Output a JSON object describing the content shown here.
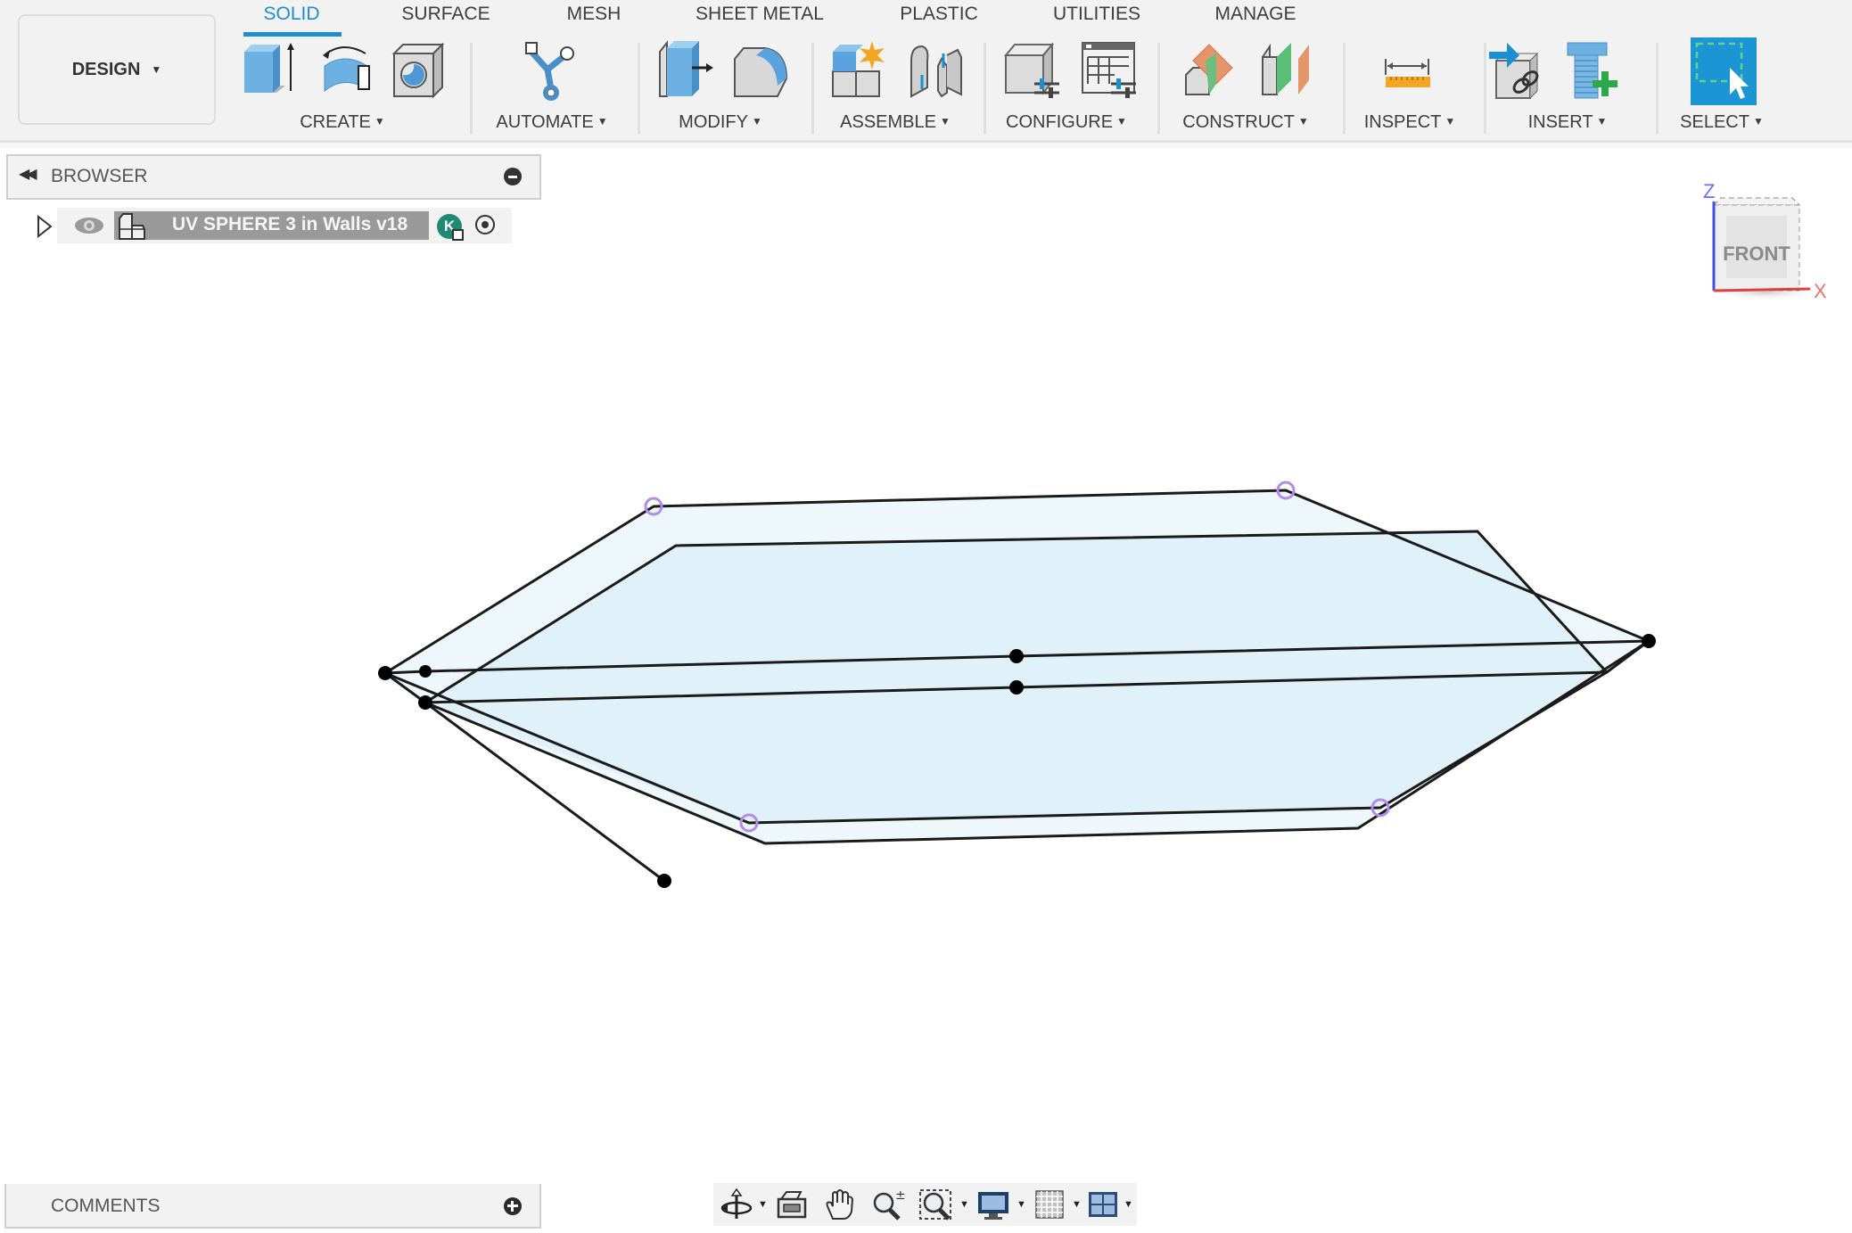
{
  "app": {
    "workspace_button": "DESIGN",
    "tabs": [
      {
        "label": "SOLID",
        "active": true
      },
      {
        "label": "SURFACE",
        "active": false
      },
      {
        "label": "MESH",
        "active": false
      },
      {
        "label": "SHEET METAL",
        "active": false
      },
      {
        "label": "PLASTIC",
        "active": false
      },
      {
        "label": "UTILITIES",
        "active": false
      },
      {
        "label": "MANAGE",
        "active": false
      }
    ],
    "groups": [
      {
        "label": "CREATE",
        "icons": [
          "extrude-icon",
          "revolve-icon",
          "hole-icon"
        ]
      },
      {
        "label": "AUTOMATE",
        "icons": [
          "automate-icon"
        ]
      },
      {
        "label": "MODIFY",
        "icons": [
          "press-pull-icon",
          "fillet-icon"
        ]
      },
      {
        "label": "ASSEMBLE",
        "icons": [
          "new-component-icon",
          "joint-icon"
        ]
      },
      {
        "label": "CONFIGURE",
        "icons": [
          "configure-model-icon",
          "configuration-table-icon"
        ]
      },
      {
        "label": "CONSTRUCT",
        "icons": [
          "offset-plane-icon",
          "midplane-icon"
        ]
      },
      {
        "label": "INSPECT",
        "icons": [
          "measure-icon"
        ]
      },
      {
        "label": "INSERT",
        "icons": [
          "insert-derive-icon",
          "insert-mcmaster-icon"
        ]
      },
      {
        "label": "SELECT",
        "icons": [
          "window-select-icon"
        ]
      }
    ]
  },
  "browser": {
    "title": "BROWSER",
    "document": {
      "name": "UV SPHERE 3 in Walls v18",
      "badge": "K"
    }
  },
  "viewcube": {
    "face": "FRONT",
    "axis_z": "Z",
    "axis_x": "X"
  },
  "comments": {
    "title": "COMMENTS"
  },
  "navbar": {
    "tools": [
      "orbit-icon",
      "look-at-icon",
      "pan-icon",
      "zoom-icon",
      "fit-window-icon",
      "display-settings-icon",
      "grid-settings-icon",
      "viewports-icon"
    ]
  },
  "colors": {
    "accent": "#1b8fd2",
    "surface_fill": "#e1f1fa",
    "surface_outer_fill": "#eef7fc",
    "edge": "#1a1a1a",
    "sketch_point_hint": "#b48be8"
  }
}
